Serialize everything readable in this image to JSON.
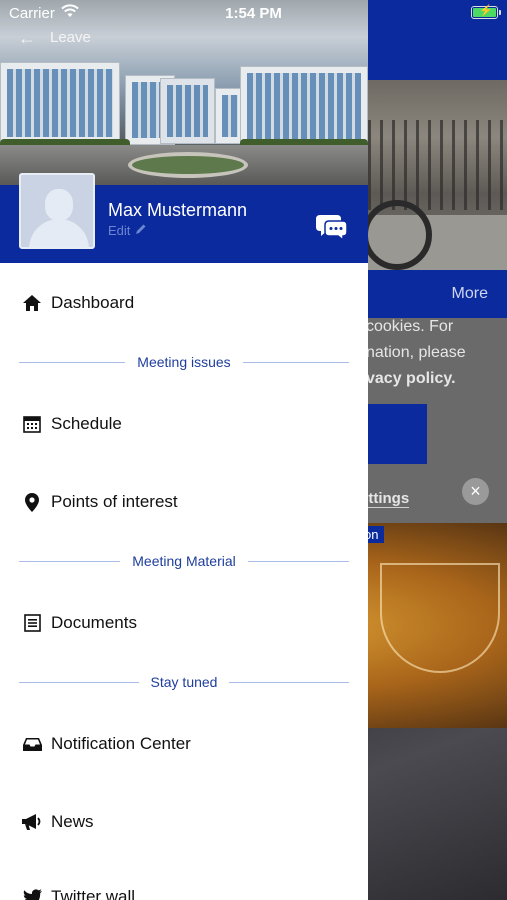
{
  "status_bar": {
    "carrier": "Carrier",
    "time": "1:54 PM"
  },
  "header": {
    "back_label": "Leave"
  },
  "profile": {
    "name": "Max Mustermann",
    "edit_label": "Edit"
  },
  "menu": {
    "dashboard": "Dashboard",
    "section_meeting_issues": "Meeting issues",
    "schedule": "Schedule",
    "points_of_interest": "Points of interest",
    "section_meeting_material": "Meeting Material",
    "documents": "Documents",
    "section_stay_tuned": "Stay tuned",
    "notification_center": "Notification Center",
    "news": "News",
    "twitter_wall": "Twitter wall"
  },
  "background_app": {
    "more_label": "More",
    "cookie_line1": "cookies. For",
    "cookie_line2": "nation, please",
    "cookie_line3": "vacy policy.",
    "settings_label": "ettings",
    "tag_label": "on"
  },
  "colors": {
    "brand_blue": "#0a2a9e",
    "section_label": "#1f3e9c",
    "battery": "#4cd964"
  }
}
